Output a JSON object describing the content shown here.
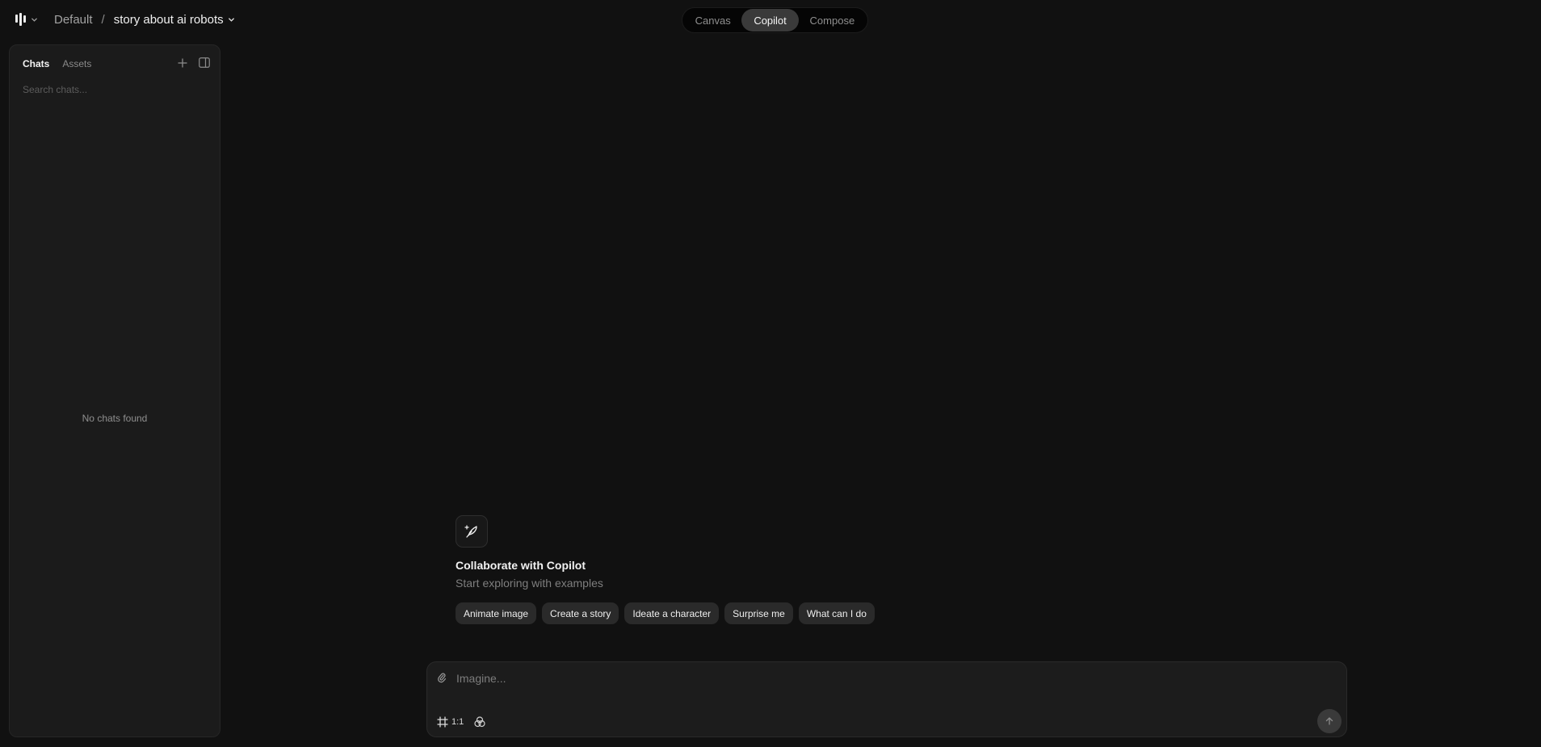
{
  "header": {
    "logo_icon": "app-logo-icon",
    "workspace": "Default",
    "separator": "/",
    "project": "story about ai robots"
  },
  "mode_switch": {
    "canvas": "Canvas",
    "copilot": "Copilot",
    "compose": "Compose",
    "active": "Copilot"
  },
  "sidebar": {
    "tabs": {
      "chats": "Chats",
      "assets": "Assets"
    },
    "active_tab": "Chats",
    "search_placeholder": "Search chats...",
    "empty_message": "No chats found"
  },
  "welcome": {
    "icon": "copilot-feather-icon",
    "title": "Collaborate with Copilot",
    "subtitle": "Start exploring with examples",
    "chips": [
      "Animate image",
      "Create a story",
      "Ideate a character",
      "Surprise me",
      "What can I do"
    ]
  },
  "composer": {
    "placeholder": "Imagine...",
    "aspect_ratio": "1:1"
  },
  "colors": {
    "background": "#111111",
    "panel": "#1b1b1b",
    "active_pill": "#3a3a3a"
  }
}
